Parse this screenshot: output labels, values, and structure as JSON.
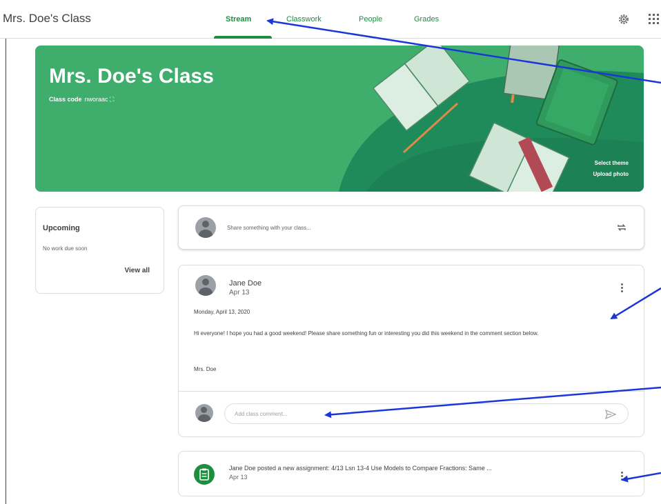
{
  "header": {
    "title": "Mrs. Doe's Class",
    "tabs": [
      {
        "label": "Stream",
        "active": true
      },
      {
        "label": "Classwork"
      },
      {
        "label": "People"
      },
      {
        "label": "Grades"
      }
    ],
    "icons": [
      "settings-icon",
      "apps-icon"
    ]
  },
  "banner": {
    "title": "Mrs. Doe's Class",
    "class_code_label": "Class code",
    "class_code": "nworaac",
    "select_theme": "Select theme",
    "upload_photo": "Upload photo"
  },
  "upcoming": {
    "title": "Upcoming",
    "subtitle": "No work due soon",
    "link": "View all"
  },
  "share": {
    "placeholder": "Share something with your class..."
  },
  "post": {
    "author": "Jane Doe",
    "date": "Apr 13",
    "line1": "Monday, April 13, 2020",
    "line2": "Hi everyone! I hope you had a good weekend! Please share something fun or interesting you did this weekend in the comment section below.",
    "signature": "Mrs. Doe",
    "comment_placeholder": "Add class comment..."
  },
  "assignment": {
    "text": "Jane Doe posted a new assignment: 4/13 Lsn 13-4 Use Models to Compare Fractions: Same ...",
    "date": "Apr 13"
  },
  "colors": {
    "accent": "#1e8e3e",
    "banner": "#3fae6d",
    "annotation_arrows": "#1a36d9"
  }
}
